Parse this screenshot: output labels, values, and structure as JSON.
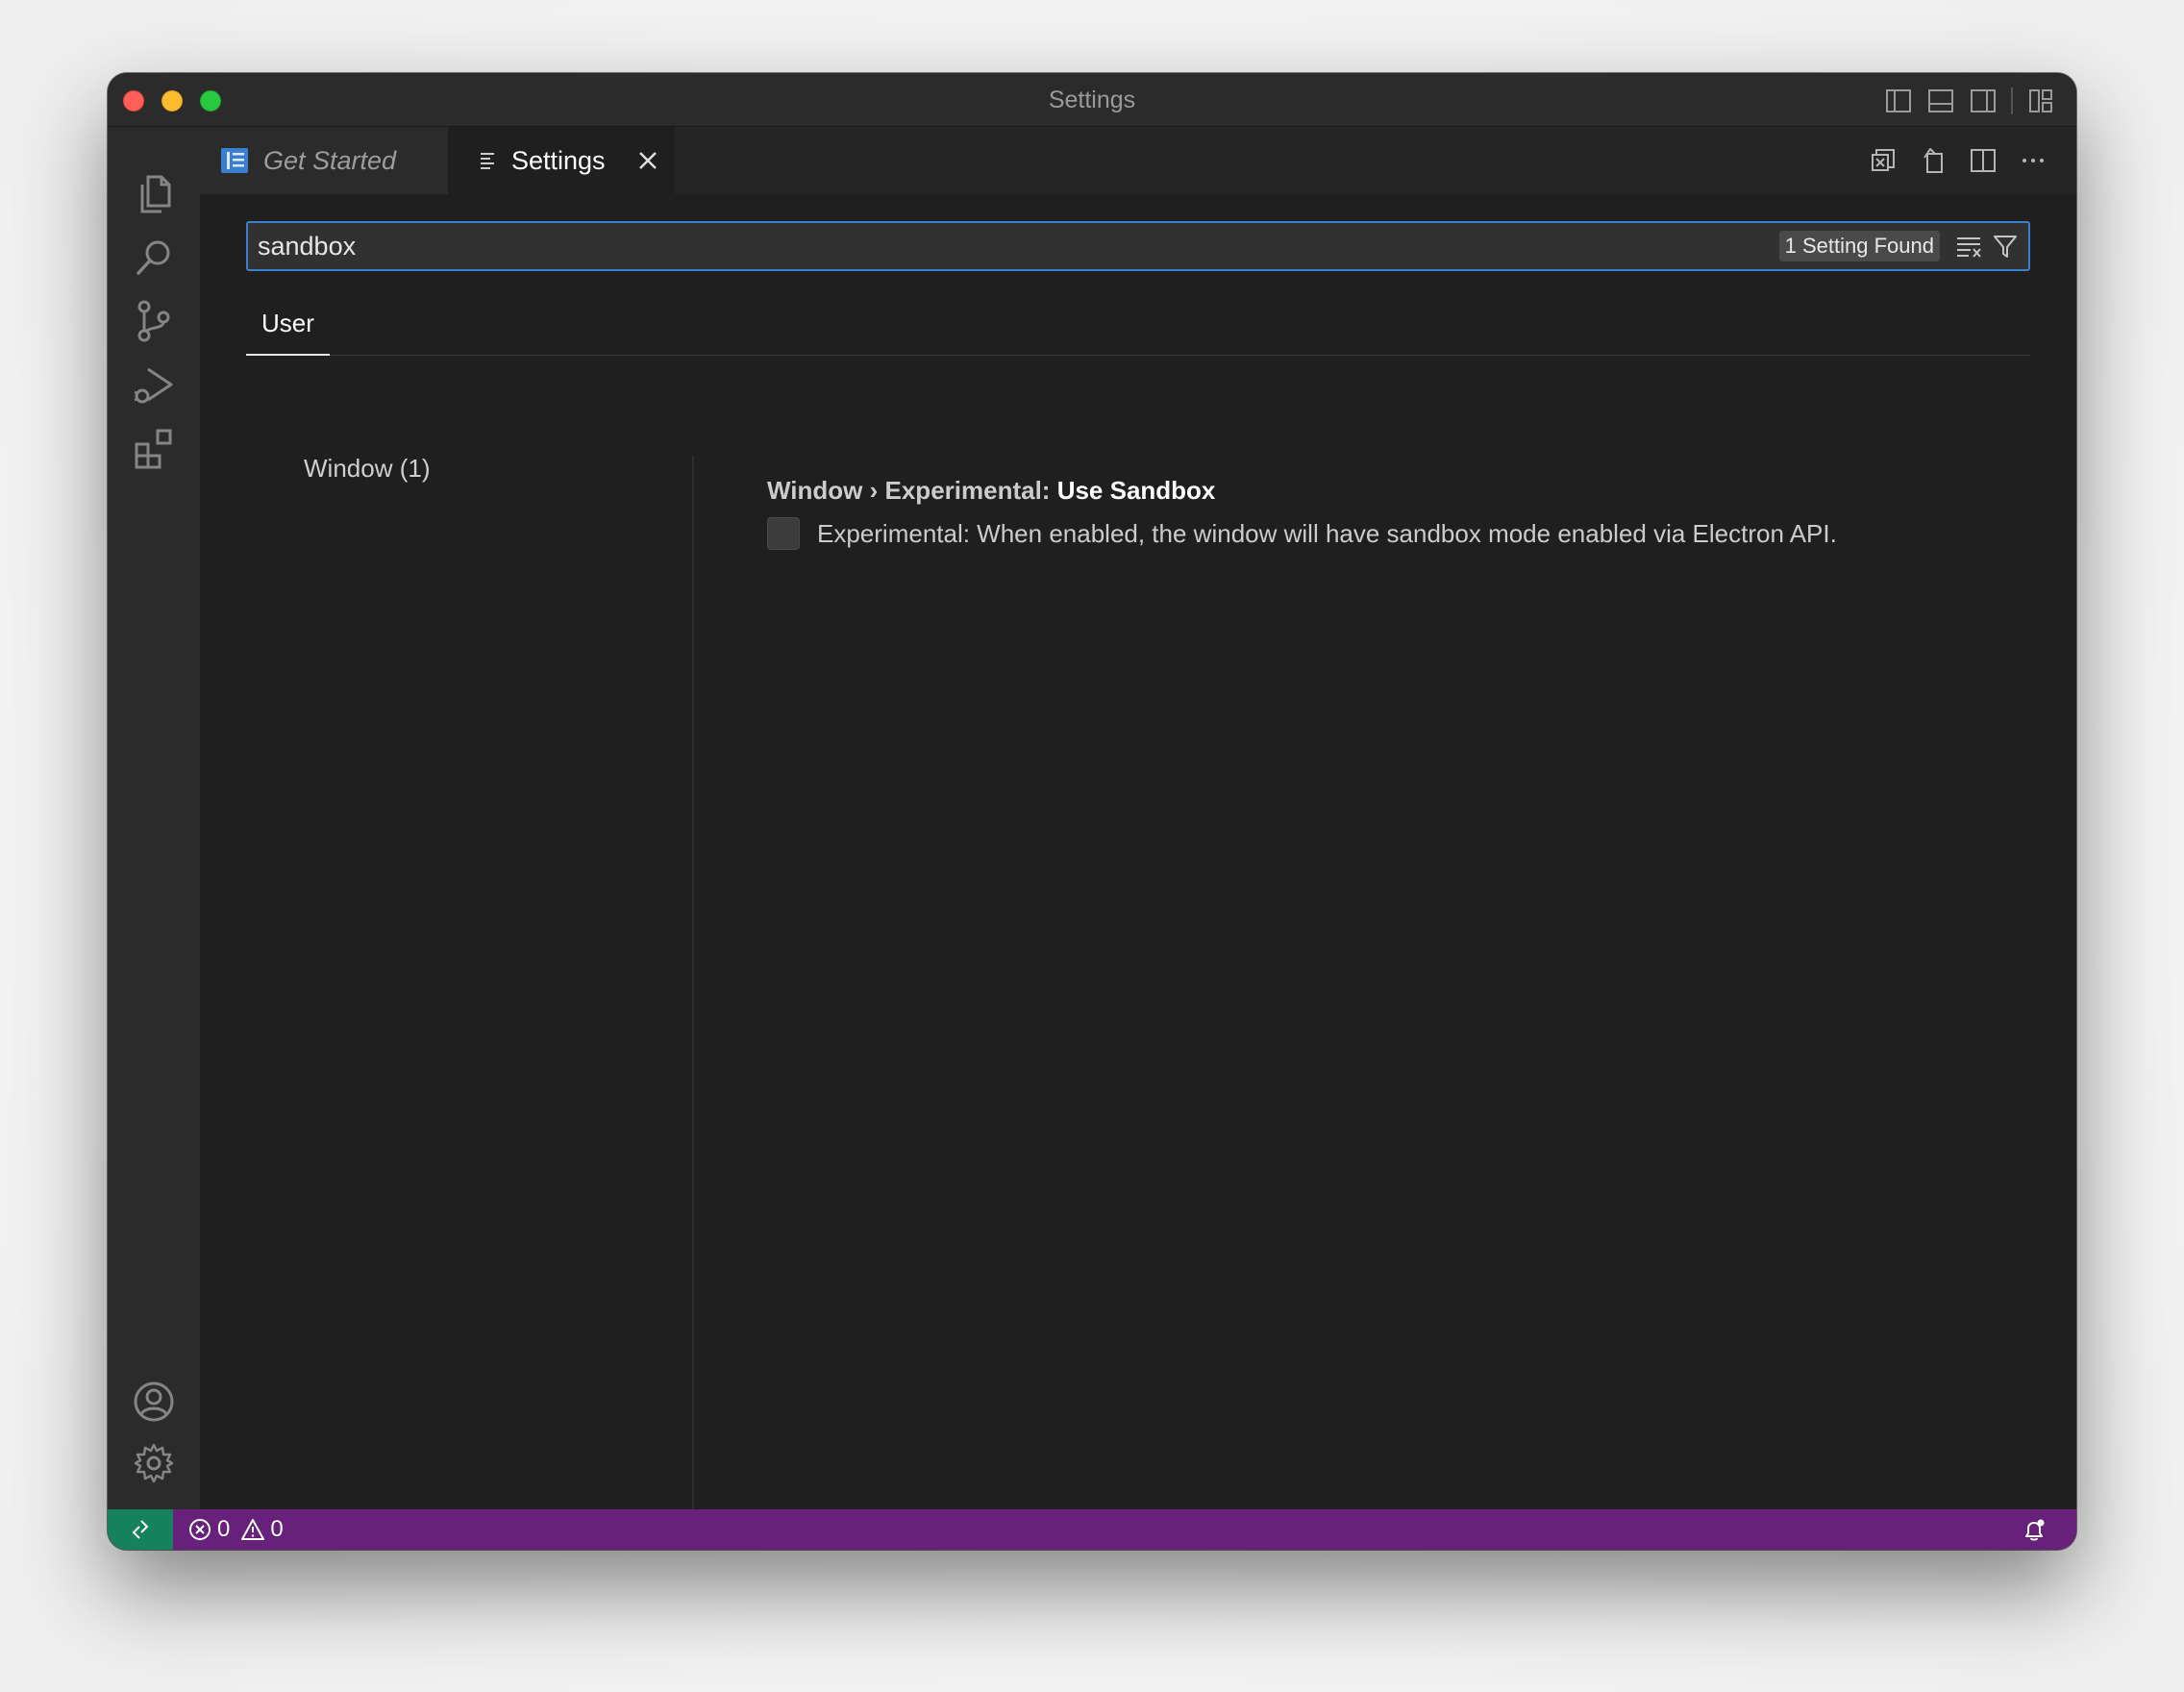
{
  "window": {
    "title": "Settings"
  },
  "tabs": [
    {
      "label": "Get Started",
      "icon": "get-started-icon",
      "active": false
    },
    {
      "label": "Settings",
      "icon": "settings-lines-icon",
      "active": true
    }
  ],
  "search": {
    "value": "sandbox",
    "placeholder": "Search settings",
    "result_count": "1 Setting Found"
  },
  "scope": {
    "active": "User"
  },
  "toc": {
    "items": [
      "Window (1)"
    ]
  },
  "setting": {
    "breadcrumb": "Window › Experimental: ",
    "key": "Use Sandbox",
    "description": "Experimental: When enabled, the window will have sandbox mode enabled via Electron API.",
    "checked": false
  },
  "statusbar": {
    "errors": "0",
    "warnings": "0"
  },
  "colors": {
    "statusbar": "#68217a",
    "remote": "#16825d",
    "focus_border": "#3b7fd3",
    "editor_bg": "#1f1f1f"
  }
}
